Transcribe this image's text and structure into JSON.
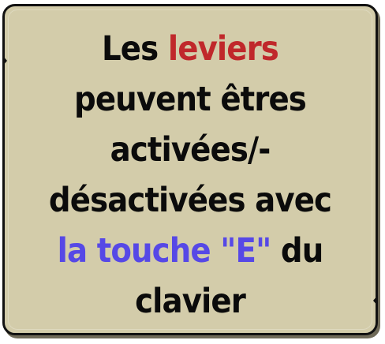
{
  "dialog": {
    "message": {
      "part1": "Les ",
      "keyword_levers": "leviers",
      "part2": " peuvent êtres activées/-désactivées avec ",
      "keyword_key": "la touche \"E\"",
      "part3": " du clavier"
    },
    "colors": {
      "panel_background": "#d3ccaa",
      "border": "#111111",
      "text": "#0b0b0b",
      "highlight_red": "#c0282b",
      "highlight_blue": "#5648e6"
    }
  }
}
